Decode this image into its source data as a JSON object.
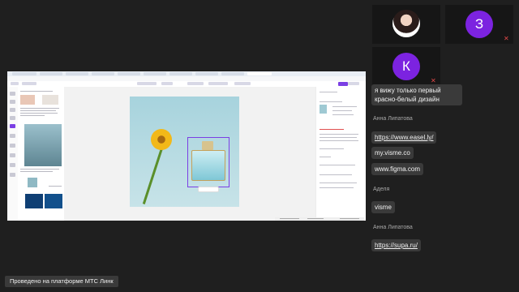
{
  "participants": [
    {
      "type": "photo",
      "muted": false
    },
    {
      "initial": "З",
      "color": "#7c23e0",
      "muted": true
    },
    {
      "initial": "К",
      "color": "#7c23e0",
      "muted": true
    }
  ],
  "chat": {
    "messages": [
      {
        "text": "я вижу только первый красно-белый дизайн"
      },
      {
        "author": "Анна Липатова"
      },
      {
        "text": "https://www.easel.ly/"
      },
      {
        "text": "my.visme.co"
      },
      {
        "text": "www.figma.com"
      },
      {
        "author": "Аделя"
      },
      {
        "text": "visme"
      },
      {
        "author": "Анна Липатова"
      },
      {
        "text": "https://supa.ru/"
      }
    ]
  },
  "footer": {
    "text": "Проведено на платформе МТС Линк"
  },
  "icons": {
    "mute": "mic-off-icon"
  }
}
